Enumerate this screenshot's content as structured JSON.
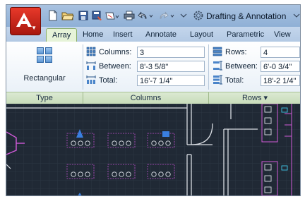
{
  "titlebar": {
    "workspace": "Drafting & Annotation"
  },
  "tabs": [
    "Array",
    "Home",
    "Insert",
    "Annotate",
    "Layout",
    "Parametric",
    "View"
  ],
  "ribbon": {
    "type_panel": {
      "title": "Type",
      "button_label": "Rectangular"
    },
    "columns_panel": {
      "title": "Columns",
      "columns_label": "Columns:",
      "columns_value": "3",
      "between_label": "Between:",
      "between_value": "8'-3 5/8\"",
      "total_label": "Total:",
      "total_value": "16'-7 1/4\""
    },
    "rows_panel": {
      "title": "Rows ▾",
      "rows_label": "Rows:",
      "rows_value": "4",
      "between_label": "Between:",
      "between_value": "6'-0 3/4\"",
      "total_label": "Total:",
      "total_value": "18'-2 1/4\""
    }
  },
  "colors": {
    "accent": "#e8392a",
    "ribbon_panel_title": "#c8dcba",
    "canvas_bg": "#202935",
    "furniture_magenta": "#d05ad8",
    "furniture_cyan": "#3fc8e8",
    "chair_blue": "#3a7fe0",
    "walls": "#d9dde3"
  },
  "icons": {
    "app_menu": "autocad-logo-icon",
    "qat": [
      "new-icon",
      "open-icon",
      "save-icon",
      "save-as-icon",
      "plot-icon",
      "print-icon",
      "undo-icon",
      "redo-icon"
    ],
    "workspace": "gear-icon"
  }
}
